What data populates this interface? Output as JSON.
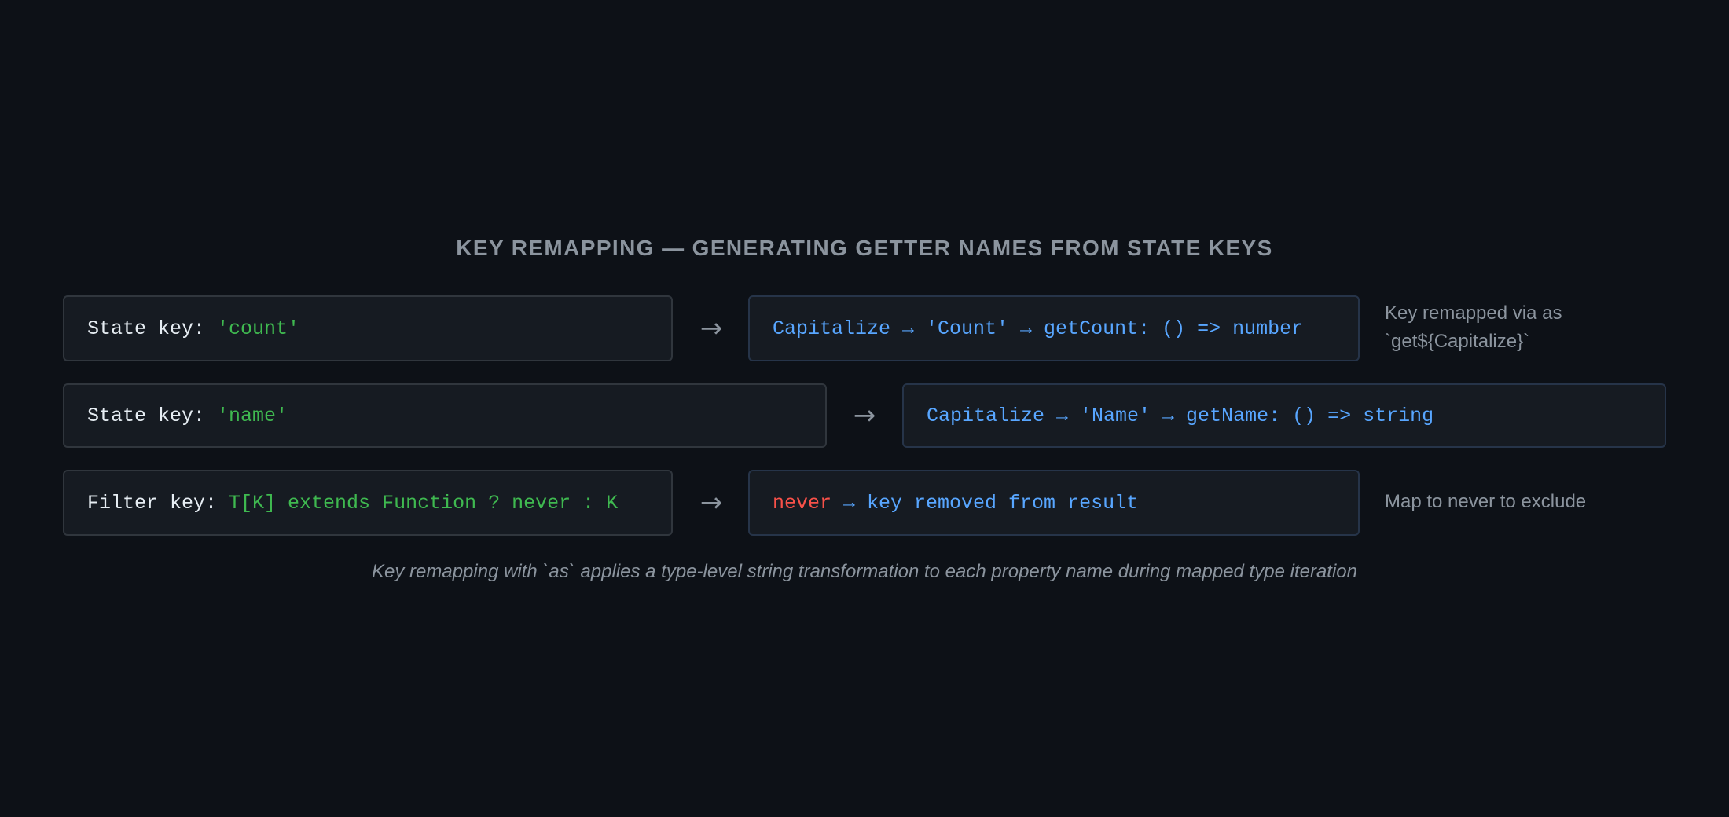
{
  "title": "KEY REMAPPING — GENERATING GETTER NAMES FROM STATE KEYS",
  "rows": [
    {
      "input": {
        "prefix": "State key: ",
        "value": "'count'"
      },
      "arrow": "→",
      "output": {
        "text": "Capitalize → 'Count' → getCount: () => number"
      },
      "note_lines": [
        "Key remapped via as",
        "`get${Capitalize}`"
      ]
    },
    {
      "input": {
        "prefix": "State key: ",
        "value": "'name'"
      },
      "arrow": "→",
      "output": {
        "text": "Capitalize → 'Name' → getName: () => string"
      }
    },
    {
      "input": {
        "prefix": "Filter key: ",
        "value": "T[K] extends Function ? never : K"
      },
      "arrow": "→",
      "output": {
        "keyword": "never",
        "text": " → key removed from result"
      },
      "note_lines": [
        "Map to never to exclude"
      ]
    }
  ],
  "caption": "Key remapping with `as` applies a type-level string transformation to each property name during mapped type iteration",
  "colors": {
    "background": "#0d1117",
    "box": "#161b22",
    "key_text": "#e6edf3",
    "value_text": "#3fb950",
    "output_text": "#58a6ff",
    "never_text": "#f85149",
    "muted_text": "#8b949e"
  }
}
